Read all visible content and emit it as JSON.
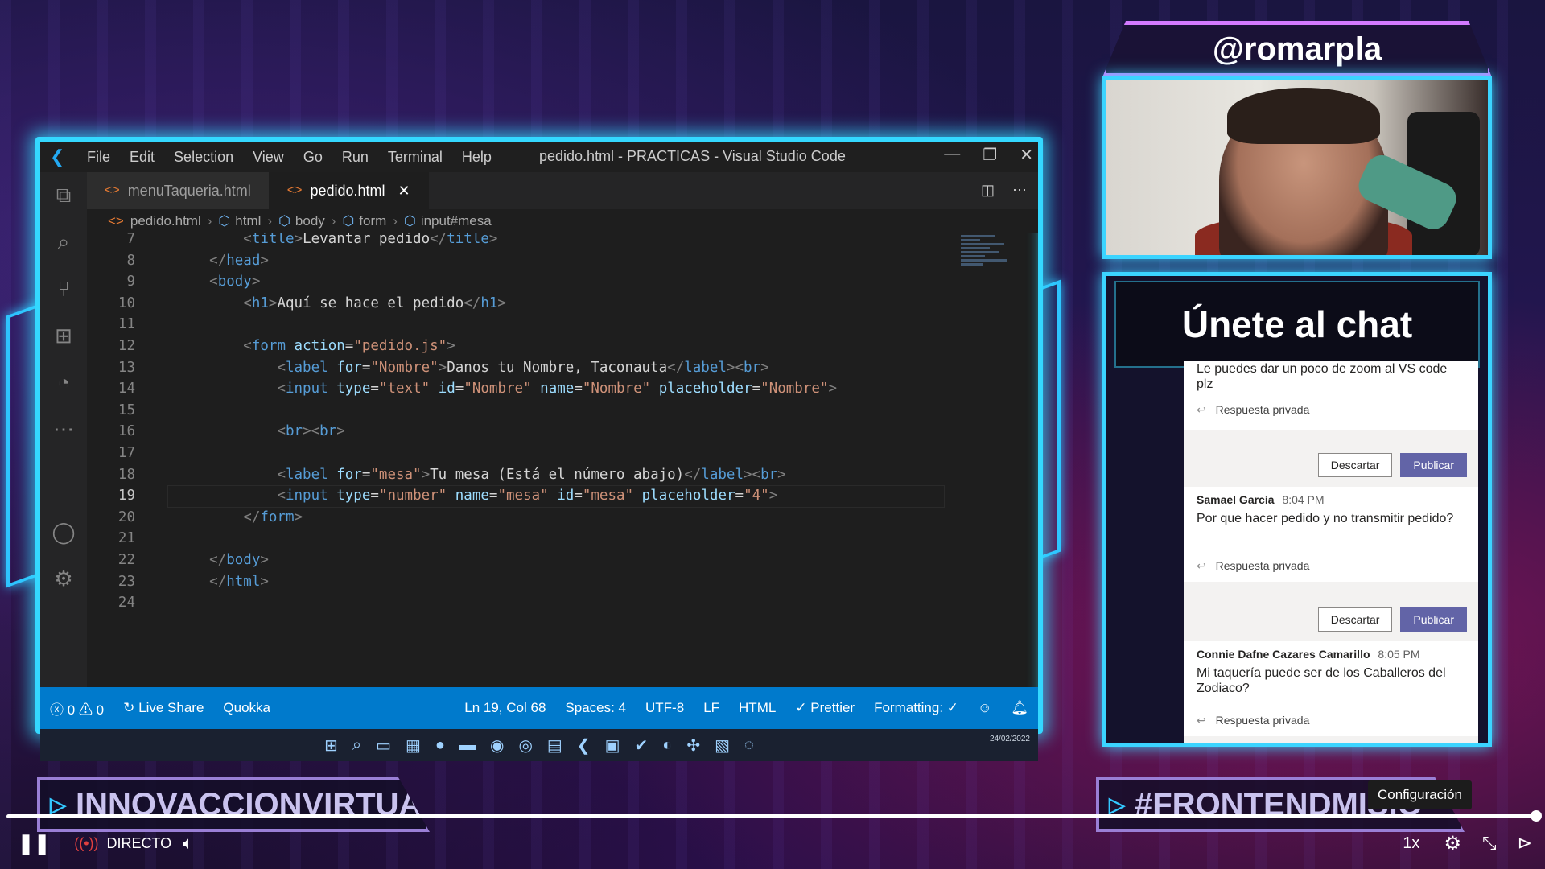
{
  "vscode": {
    "menu": [
      "File",
      "Edit",
      "Selection",
      "View",
      "Go",
      "Run",
      "Terminal",
      "Help"
    ],
    "window_title": "pedido.html - PRACTICAS - Visual Studio Code",
    "tabs": [
      {
        "label": "menuTaqueria.html",
        "active": false
      },
      {
        "label": "pedido.html",
        "active": true
      }
    ],
    "breadcrumb": [
      "pedido.html",
      "html",
      "body",
      "form",
      "input#mesa"
    ],
    "lines": [
      {
        "n": "7",
        "parts": [
          [
            "i",
            "        "
          ],
          [
            "br",
            "<"
          ],
          [
            "tag",
            "title"
          ],
          [
            "br",
            ">"
          ],
          [
            "txt",
            "Levantar pedido"
          ],
          [
            "br",
            "</"
          ],
          [
            "tag",
            "title"
          ],
          [
            "br",
            ">"
          ]
        ]
      },
      {
        "n": "8",
        "parts": [
          [
            "i",
            "    "
          ],
          [
            "br",
            "</"
          ],
          [
            "tag",
            "head"
          ],
          [
            "br",
            ">"
          ]
        ]
      },
      {
        "n": "9",
        "parts": [
          [
            "i",
            "    "
          ],
          [
            "br",
            "<"
          ],
          [
            "tag",
            "body"
          ],
          [
            "br",
            ">"
          ]
        ]
      },
      {
        "n": "10",
        "parts": [
          [
            "i",
            "        "
          ],
          [
            "br",
            "<"
          ],
          [
            "tag",
            "h1"
          ],
          [
            "br",
            ">"
          ],
          [
            "txt",
            "Aquí se hace el pedido"
          ],
          [
            "br",
            "</"
          ],
          [
            "tag",
            "h1"
          ],
          [
            "br",
            ">"
          ]
        ]
      },
      {
        "n": "11",
        "parts": []
      },
      {
        "n": "12",
        "parts": [
          [
            "i",
            "        "
          ],
          [
            "br",
            "<"
          ],
          [
            "tag",
            "form"
          ],
          [
            "txt",
            " "
          ],
          [
            "attr",
            "action"
          ],
          [
            "txt",
            "="
          ],
          [
            "str",
            "\"pedido.js\""
          ],
          [
            "br",
            ">"
          ]
        ]
      },
      {
        "n": "13",
        "parts": [
          [
            "i",
            "            "
          ],
          [
            "br",
            "<"
          ],
          [
            "tag",
            "label"
          ],
          [
            "txt",
            " "
          ],
          [
            "attr",
            "for"
          ],
          [
            "txt",
            "="
          ],
          [
            "str",
            "\"Nombre\""
          ],
          [
            "br",
            ">"
          ],
          [
            "txt",
            "Danos tu Nombre, Taconauta"
          ],
          [
            "br",
            "</"
          ],
          [
            "tag",
            "label"
          ],
          [
            "br",
            "><"
          ],
          [
            "tag",
            "br"
          ],
          [
            "br",
            ">"
          ]
        ]
      },
      {
        "n": "14",
        "parts": [
          [
            "i",
            "            "
          ],
          [
            "br",
            "<"
          ],
          [
            "tag",
            "input"
          ],
          [
            "txt",
            " "
          ],
          [
            "attr",
            "type"
          ],
          [
            "txt",
            "="
          ],
          [
            "str",
            "\"text\""
          ],
          [
            "txt",
            " "
          ],
          [
            "attr",
            "id"
          ],
          [
            "txt",
            "="
          ],
          [
            "str",
            "\"Nombre\""
          ],
          [
            "txt",
            " "
          ],
          [
            "attr",
            "name"
          ],
          [
            "txt",
            "="
          ],
          [
            "str",
            "\"Nombre\""
          ],
          [
            "txt",
            " "
          ],
          [
            "attr",
            "placeholder"
          ],
          [
            "txt",
            "="
          ],
          [
            "str",
            "\"Nombre\""
          ],
          [
            "br",
            ">"
          ]
        ]
      },
      {
        "n": "15",
        "parts": []
      },
      {
        "n": "16",
        "parts": [
          [
            "i",
            "            "
          ],
          [
            "br",
            "<"
          ],
          [
            "tag",
            "br"
          ],
          [
            "br",
            "><"
          ],
          [
            "tag",
            "br"
          ],
          [
            "br",
            ">"
          ]
        ]
      },
      {
        "n": "17",
        "parts": []
      },
      {
        "n": "18",
        "parts": [
          [
            "i",
            "            "
          ],
          [
            "br",
            "<"
          ],
          [
            "tag",
            "label"
          ],
          [
            "txt",
            " "
          ],
          [
            "attr",
            "for"
          ],
          [
            "txt",
            "="
          ],
          [
            "str",
            "\"mesa\""
          ],
          [
            "br",
            ">"
          ],
          [
            "txt",
            "Tu mesa (Está el número abajo)"
          ],
          [
            "br",
            "</"
          ],
          [
            "tag",
            "label"
          ],
          [
            "br",
            "><"
          ],
          [
            "tag",
            "br"
          ],
          [
            "br",
            ">"
          ]
        ]
      },
      {
        "n": "19",
        "parts": [
          [
            "i",
            "            "
          ],
          [
            "br",
            "<"
          ],
          [
            "tag",
            "input"
          ],
          [
            "txt",
            " "
          ],
          [
            "attr",
            "type"
          ],
          [
            "txt",
            "="
          ],
          [
            "str",
            "\"number\""
          ],
          [
            "txt",
            " "
          ],
          [
            "attr",
            "name"
          ],
          [
            "txt",
            "="
          ],
          [
            "str",
            "\"mesa\""
          ],
          [
            "txt",
            " "
          ],
          [
            "attr",
            "id"
          ],
          [
            "txt",
            "="
          ],
          [
            "str",
            "\"mesa\""
          ],
          [
            "txt",
            " "
          ],
          [
            "attr",
            "placeholder"
          ],
          [
            "txt",
            "="
          ],
          [
            "str",
            "\"4\""
          ],
          [
            "br",
            ">"
          ]
        ]
      },
      {
        "n": "20",
        "parts": [
          [
            "i",
            "        "
          ],
          [
            "br",
            "</"
          ],
          [
            "tag",
            "form"
          ],
          [
            "br",
            ">"
          ]
        ]
      },
      {
        "n": "21",
        "parts": []
      },
      {
        "n": "22",
        "parts": [
          [
            "i",
            "    "
          ],
          [
            "br",
            "</"
          ],
          [
            "tag",
            "body"
          ],
          [
            "br",
            ">"
          ]
        ]
      },
      {
        "n": "23",
        "parts": [
          [
            "i",
            "    "
          ],
          [
            "br",
            "</"
          ],
          [
            "tag",
            "html"
          ],
          [
            "br",
            ">"
          ]
        ]
      },
      {
        "n": "24",
        "parts": []
      }
    ],
    "current_line": "19",
    "status": {
      "errors": "0",
      "warnings": "0",
      "live_share": "Live Share",
      "quokka": "Quokka",
      "position": "Ln 19, Col 68",
      "spaces": "Spaces: 4",
      "encoding": "UTF-8",
      "eol": "LF",
      "language": "HTML",
      "prettier": "Prettier",
      "formatting": "Formatting: ✓"
    },
    "taskbar_date": "24/02/2022"
  },
  "stream": {
    "handle": "@romarpla",
    "chat_title": "Únete al chat",
    "messages": [
      {
        "author": "",
        "time": "",
        "text": "Le puedes dar un poco de zoom al VS code plz",
        "reply": "Respuesta privada"
      },
      {
        "author": "Samael García",
        "time": "8:04 PM",
        "text": "Por que hacer pedido y no transmitir pedido?",
        "reply": "Respuesta privada"
      },
      {
        "author": "Connie Dafne Cazares Camarillo",
        "time": "8:05 PM",
        "text": "Mi taquería puede ser de los Caballeros del Zodiaco?",
        "reply": "Respuesta privada"
      }
    ],
    "buttons": {
      "discard": "Descartar",
      "publish": "Publicar"
    },
    "banner_left": "INNOVACCIONVIRTUAL",
    "banner_right": "#FRONTENDMISIO"
  },
  "player": {
    "live_label": "DIRECTO",
    "speed": "1x",
    "tooltip": "Configuración",
    "progress": 1.0
  },
  "colors": {
    "neon_cyan": "#34d8ff",
    "neon_purple": "#d37aff",
    "vscode_status": "#007acc",
    "teams_purple": "#6264a7"
  }
}
